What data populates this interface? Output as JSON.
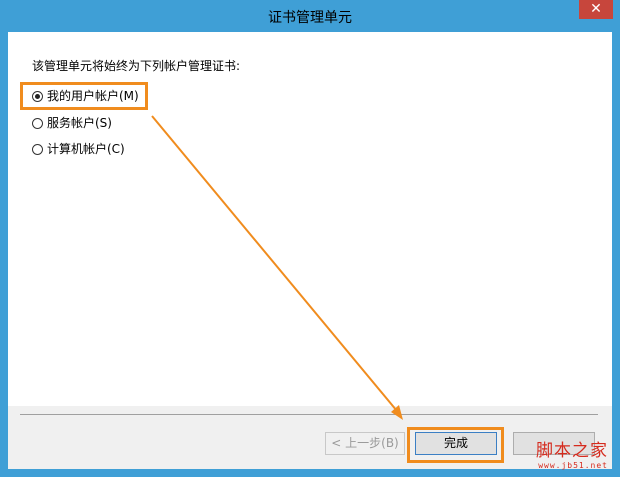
{
  "window": {
    "title": "证书管理单元",
    "close_glyph": "✕"
  },
  "content": {
    "instruction": "该管理单元将始终为下列帐户管理证书:",
    "options": [
      {
        "label": "我的用户帐户(M)",
        "selected": true
      },
      {
        "label": "服务帐户(S)",
        "selected": false
      },
      {
        "label": "计算机帐户(C)",
        "selected": false
      }
    ]
  },
  "buttons": {
    "back": "< 上一步(B)",
    "finish": "完成",
    "cancel": ""
  },
  "watermark": {
    "main": "脚本之家",
    "sub": "www.jb51.net"
  },
  "colors": {
    "title_bar": "#3f9fd6",
    "highlight": "#f08c1e",
    "close_button": "#c7463c",
    "watermark": "#d52b1e"
  }
}
